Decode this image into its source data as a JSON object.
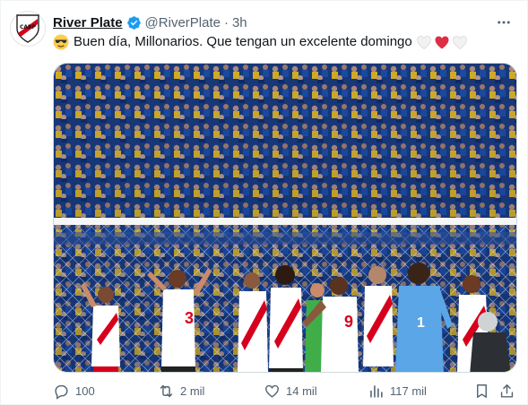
{
  "post": {
    "author_name": "River Plate",
    "handle": "@RiverPlate",
    "separator": "·",
    "time": "3h",
    "text": "Buen día, Millonarios. Que tengan un excelente domingo",
    "leading_emoji": "sunglasses-emoji",
    "trailing_emojis": [
      "white-heart",
      "red-heart",
      "white-heart"
    ]
  },
  "actions": {
    "replies": "100",
    "reposts": "2 mil",
    "likes": "14 mil",
    "views": "117 mil"
  },
  "colors": {
    "text": "#0f1419",
    "secondary": "#536471",
    "verified": "#1d9bf0",
    "river_red": "#d6001c",
    "boca_blue": "#0b2a6b",
    "boca_yellow": "#f6c400"
  },
  "icons": [
    "verified-icon",
    "more-icon",
    "reply-icon",
    "repost-icon",
    "like-icon",
    "views-icon",
    "bookmark-icon",
    "share-icon"
  ]
}
